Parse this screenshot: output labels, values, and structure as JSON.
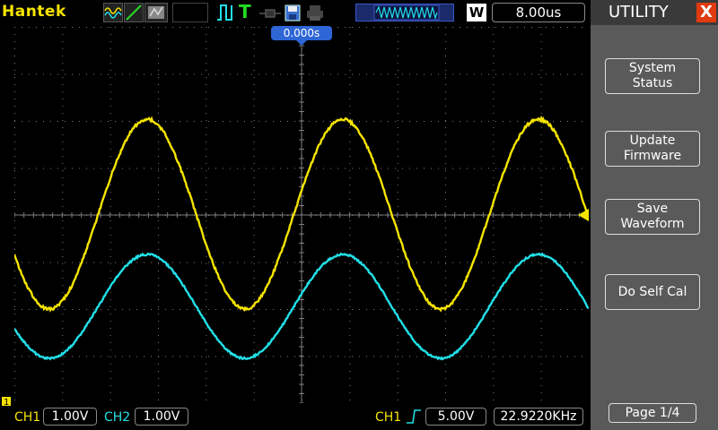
{
  "topbar": {
    "brand": "Hantek",
    "timebase": "8.00us",
    "w_badge": "W",
    "t_icon": "T",
    "icons": [
      "wave-mode-icon",
      "line-mode-icon",
      "persist-mode-icon",
      "trigger-edge-icon",
      "trigger-type-icon",
      "probe-icon",
      "save-icon",
      "print-icon",
      "memory-waveform-icon"
    ]
  },
  "screen": {
    "trigger_position": "0.000s",
    "colors": {
      "ch1": "#f5e400",
      "ch2": "#22e0e8",
      "grid": "#7a7a7a",
      "trigger_marker": "#f5e400"
    }
  },
  "side": {
    "title": "UTILITY",
    "close_label": "X",
    "buttons": [
      "System\nStatus",
      "Update\nFirmware",
      "Save\nWaveform",
      "Do Self Cal"
    ],
    "page": "Page 1/4"
  },
  "bottom": {
    "ch1_label": "CH1",
    "ch1_scale": "1.00V",
    "ch2_label": "CH2",
    "ch2_scale": "1.00V",
    "trig_source": "CH1",
    "trig_level": "5.00V",
    "frequency": "22.9220KHz"
  }
}
